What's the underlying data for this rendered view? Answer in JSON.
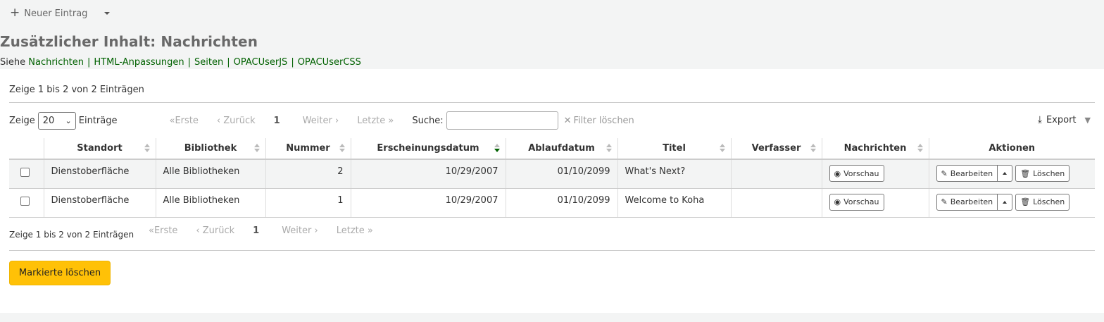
{
  "toolbar": {
    "new_entry_label": "Neuer Eintrag"
  },
  "page_title": "Zusätzlicher Inhalt: Nachrichten",
  "see": {
    "prefix": "Siehe",
    "links": [
      "Nachrichten",
      "HTML-Anpassungen",
      "Seiten",
      "OPACUserJS",
      "OPACUserCSS"
    ]
  },
  "info_top": "Zeige 1 bis 2 von 2 Einträgen",
  "info_bottom": "Zeige 1 bis 2 von 2 Einträgen",
  "controls": {
    "show_label": "Zeige",
    "page_length": "20",
    "entries_label": "Einträge",
    "search_label": "Suche:",
    "search_value": "",
    "clear_filter": "Filter löschen",
    "export": "Export"
  },
  "pager": {
    "first": "Erste",
    "prev": "Zurück",
    "current": "1",
    "next": "Weiter",
    "last": "Letzte"
  },
  "table": {
    "headers": [
      "Standort",
      "Bibliothek",
      "Nummer",
      "Erscheinungsdatum",
      "Ablaufdatum",
      "Titel",
      "Verfasser",
      "Nachrichten",
      "Aktionen"
    ],
    "sorted_by": "Erscheinungsdatum",
    "rows": [
      {
        "location": "Dienstoberfläche",
        "library": "Alle Bibliotheken",
        "number": "2",
        "published": "10/29/2007",
        "expires": "01/10/2099",
        "title": "What's Next?",
        "author": ""
      },
      {
        "location": "Dienstoberfläche",
        "library": "Alle Bibliotheken",
        "number": "1",
        "published": "10/29/2007",
        "expires": "01/10/2099",
        "title": "Welcome to Koha",
        "author": ""
      }
    ],
    "preview_label": "Vorschau",
    "edit_label": "Bearbeiten",
    "delete_label": "Löschen"
  },
  "delete_selected_label": "Markierte löschen",
  "colors": {
    "link": "#006100",
    "primary_button": "#ffc107"
  }
}
